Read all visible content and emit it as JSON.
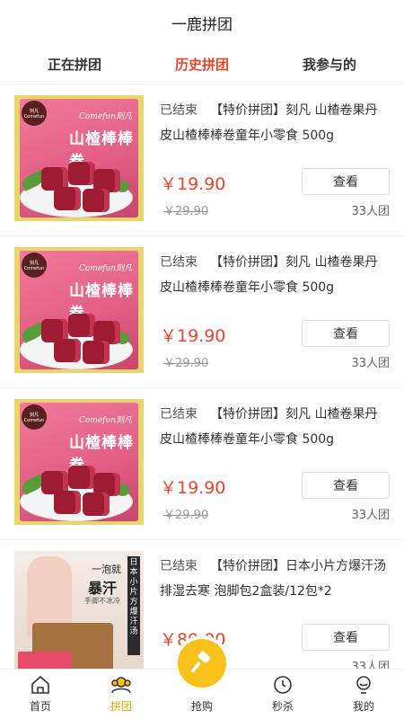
{
  "header": {
    "title": "一鹿拼团"
  },
  "tabs": [
    {
      "label": "正在拼团",
      "active": false
    },
    {
      "label": "历史拼团",
      "active": true
    },
    {
      "label": "我参与的",
      "active": false
    }
  ],
  "items": [
    {
      "status": "已结束",
      "title": "【特价拼团】刻凡 山楂卷果丹皮山楂棒棒卷童年小零食 500g",
      "price": "￥19.90",
      "original_price": "￥29.90",
      "view_label": "查看",
      "group_size": "33人团",
      "pkg_brand": "Comefun刻凡",
      "pkg_name": "山楂棒棒卷",
      "logo_text": "刻凡 Comefun"
    },
    {
      "status": "已结束",
      "title": "【特价拼团】刻凡 山楂卷果丹皮山楂棒棒卷童年小零食 500g",
      "price": "￥19.90",
      "original_price": "￥29.90",
      "view_label": "查看",
      "group_size": "33人团",
      "pkg_brand": "Comefun刻凡",
      "pkg_name": "山楂棒棒卷",
      "logo_text": "刻凡 Comefun"
    },
    {
      "status": "已结束",
      "title": "【特价拼团】刻凡 山楂卷果丹皮山楂棒棒卷童年小零食 500g",
      "price": "￥19.90",
      "original_price": "￥29.90",
      "view_label": "查看",
      "group_size": "33人团",
      "pkg_brand": "Comefun刻凡",
      "pkg_name": "山楂棒棒卷",
      "logo_text": "刻凡 Comefun"
    },
    {
      "status": "已结束",
      "title": "【特价拼团】日本小片方爆汗汤 排湿去寒 泡脚包2盒装/12包*2",
      "price": "￥89.00",
      "original_price": "",
      "view_label": "查看",
      "group_size": "33人团",
      "art_line1": "一泡就",
      "art_line2": "暴汗",
      "art_line3": "手脚不冰冷",
      "art_banner": "日本小片方爆汗汤"
    }
  ],
  "bottom_nav": [
    {
      "label": "首页",
      "icon": "home-icon",
      "active": false
    },
    {
      "label": "拼团",
      "icon": "group-icon",
      "active": true
    },
    {
      "label": "抢购",
      "icon": "hammer-icon",
      "active": false
    },
    {
      "label": "秒杀",
      "icon": "clock-icon",
      "active": false
    },
    {
      "label": "我的",
      "icon": "user-icon",
      "active": false
    }
  ],
  "colors": {
    "accent": "#e8452a",
    "nav_active": "#f0a800",
    "center_button": "#f8c21a"
  }
}
